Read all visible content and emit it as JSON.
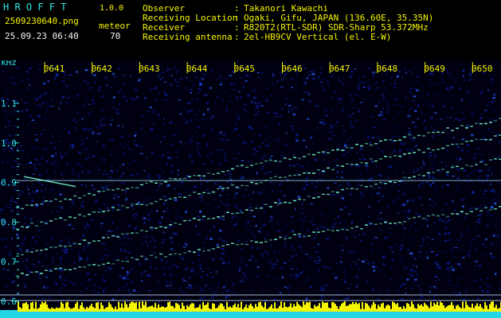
{
  "header": {
    "app_title": "H R O F F T",
    "version": "1.0.0",
    "filename": "2509230640.png",
    "mode_label": "meteor",
    "datetime": "25.09.23 06:40",
    "count": "70",
    "info": [
      {
        "label": "Observer",
        "sep": ":",
        "value": "Takanori Kawachi"
      },
      {
        "label": "Receiving Location",
        "sep": ":",
        "value": "Ogaki, Gifu, JAPAN (136.60E, 35.35N)"
      },
      {
        "label": "Receiver",
        "sep": ":",
        "value": "R820T2(RTL-SDR) SDR-Sharp 53.372MHz"
      },
      {
        "label": "Receiving antenna",
        "sep": ":",
        "value": "2el-HB9CV Vertical (el. E-W)"
      }
    ]
  },
  "spectrogram": {
    "y_unit": "kHz",
    "y_ticks": [
      "1.1",
      "1.0",
      "0.9",
      "0.8",
      "0.7",
      "0.6"
    ],
    "y_values": [
      1.1,
      1.0,
      0.9,
      0.8,
      0.7,
      0.6
    ],
    "y_range": [
      0.58,
      1.16
    ],
    "x_ticks": [
      "0641",
      "0642",
      "0643",
      "0644",
      "0645",
      "0646",
      "0647",
      "0648",
      "0649",
      "0650"
    ],
    "colors": {
      "background": "#000010",
      "noise_low": "#0a1a8c",
      "noise_high": "#2a5cff",
      "signal": "#6ff0c0",
      "carrier": "#a8e8ff",
      "tick_text": "#f4f400",
      "axis_text": "#2fe6e6",
      "bottom_band": "#f4f400",
      "bottom_base": "#22d6e6"
    }
  }
}
